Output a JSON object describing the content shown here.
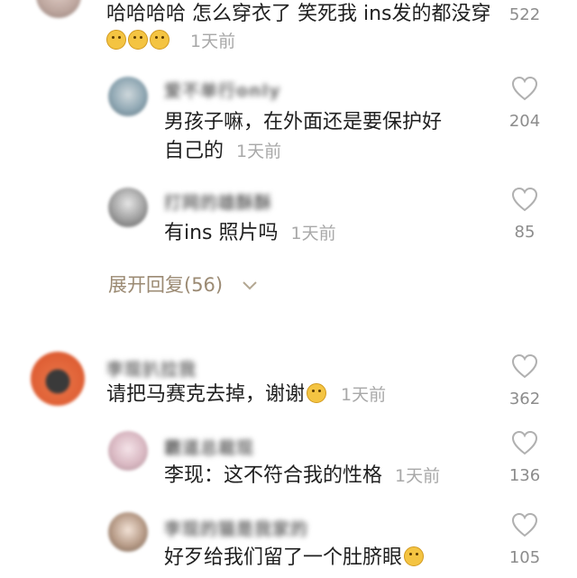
{
  "top_comment": {
    "text": "哈哈哈哈 怎么穿衣了 笑死我 ins发的都没穿",
    "time": "1天前",
    "likes": "522"
  },
  "reply_1": {
    "username": "爱不单行only",
    "line1": "男孩子嘛，在外面还是要保护好",
    "line2": "自己的",
    "time": "1天前",
    "likes": "204"
  },
  "reply_2": {
    "username": "打网的雄酥酥",
    "text": "有ins 照片吗",
    "time": "1天前",
    "likes": "85"
  },
  "expand_replies": {
    "label": "展开回复(56)",
    "icon": "chevron-down-icon"
  },
  "comment_2": {
    "username": "李现扒拉我",
    "text": "请把马赛克去掉，谢谢",
    "time": "1天前",
    "likes": "362"
  },
  "reply_3": {
    "username": "霸道总裁现",
    "text": "李现：这不符合我的性格",
    "time": "1天前",
    "likes": "136"
  },
  "reply_4": {
    "username": "李现的猫是我家的",
    "text": "好歹给我们留了一个肚脐眼",
    "likes": "105"
  },
  "colors": {
    "text": "#1f1f1f",
    "time": "#a8a8a8",
    "count": "#8c8c8c",
    "expand": "#9b8a73",
    "heart_outline": "#b0b0b0"
  },
  "icons": [
    "heart-outline-icon",
    "laugh-cry-emoji",
    "smile-emoji",
    "chevron-down-icon"
  ]
}
